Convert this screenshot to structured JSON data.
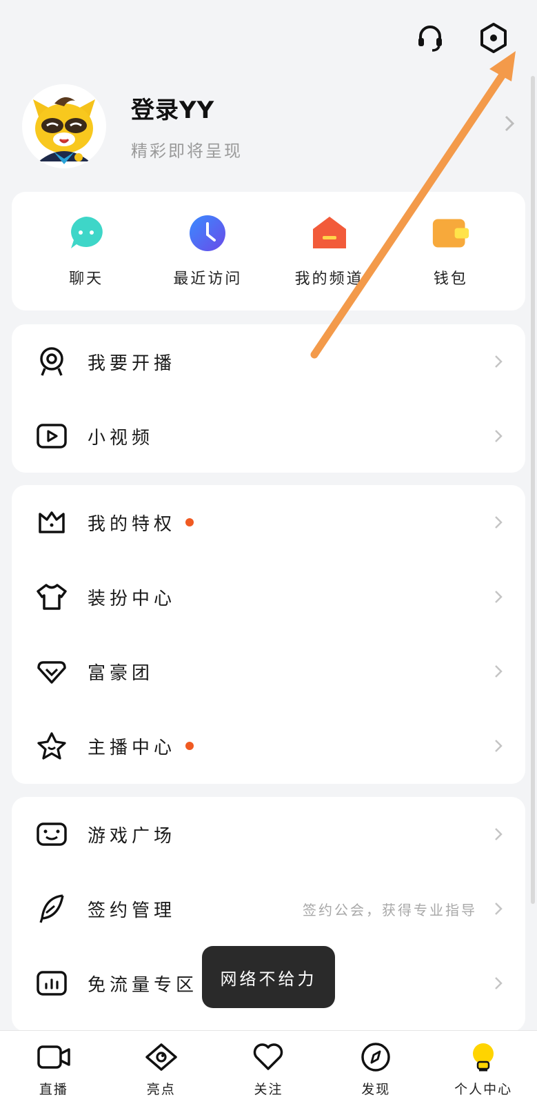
{
  "header": {
    "actions": [
      {
        "icon": "headset-icon"
      },
      {
        "icon": "settings-hexagon-icon"
      }
    ]
  },
  "profile": {
    "title": "登录YY",
    "subtitle": "精彩即将呈现"
  },
  "quick_actions": [
    {
      "label": "聊天",
      "icon": "chat-icon",
      "color": "#3ed6c8"
    },
    {
      "label": "最近访问",
      "icon": "clock-icon",
      "color": "#4c6ef5"
    },
    {
      "label": "我的频道",
      "icon": "channel-icon",
      "color": "#f25b3a"
    },
    {
      "label": "钱包",
      "icon": "wallet-icon",
      "color": "#f7b23b"
    }
  ],
  "section_live": [
    {
      "label": "我要开播",
      "icon": "webcam-icon"
    },
    {
      "label": "小视频",
      "icon": "play-video-icon"
    }
  ],
  "section_privilege": [
    {
      "label": "我的特权",
      "icon": "crown-icon",
      "dot": true
    },
    {
      "label": "装扮中心",
      "icon": "tshirt-icon"
    },
    {
      "label": "富豪团",
      "icon": "diamond-icon"
    },
    {
      "label": "主播中心",
      "icon": "star-icon",
      "dot": true
    }
  ],
  "section_game": [
    {
      "label": "游戏广场",
      "icon": "gamepad-icon"
    },
    {
      "label": "签约管理",
      "icon": "feather-icon",
      "subtitle": "签约公会，获得专业指导"
    },
    {
      "label": "免流量专区",
      "icon": "data-chart-icon"
    }
  ],
  "toast": "网络不给力",
  "bottom_nav": [
    {
      "label": "直播",
      "icon": "video-camera-icon"
    },
    {
      "label": "亮点",
      "icon": "eye-icon"
    },
    {
      "label": "关注",
      "icon": "heart-icon"
    },
    {
      "label": "发现",
      "icon": "compass-icon"
    },
    {
      "label": "个人中心",
      "icon": "bulb-icon",
      "active": true
    }
  ],
  "colors": {
    "accent_dot": "#f05a22",
    "arrow": "#f39a4a",
    "active_tab": "#ffd400"
  }
}
